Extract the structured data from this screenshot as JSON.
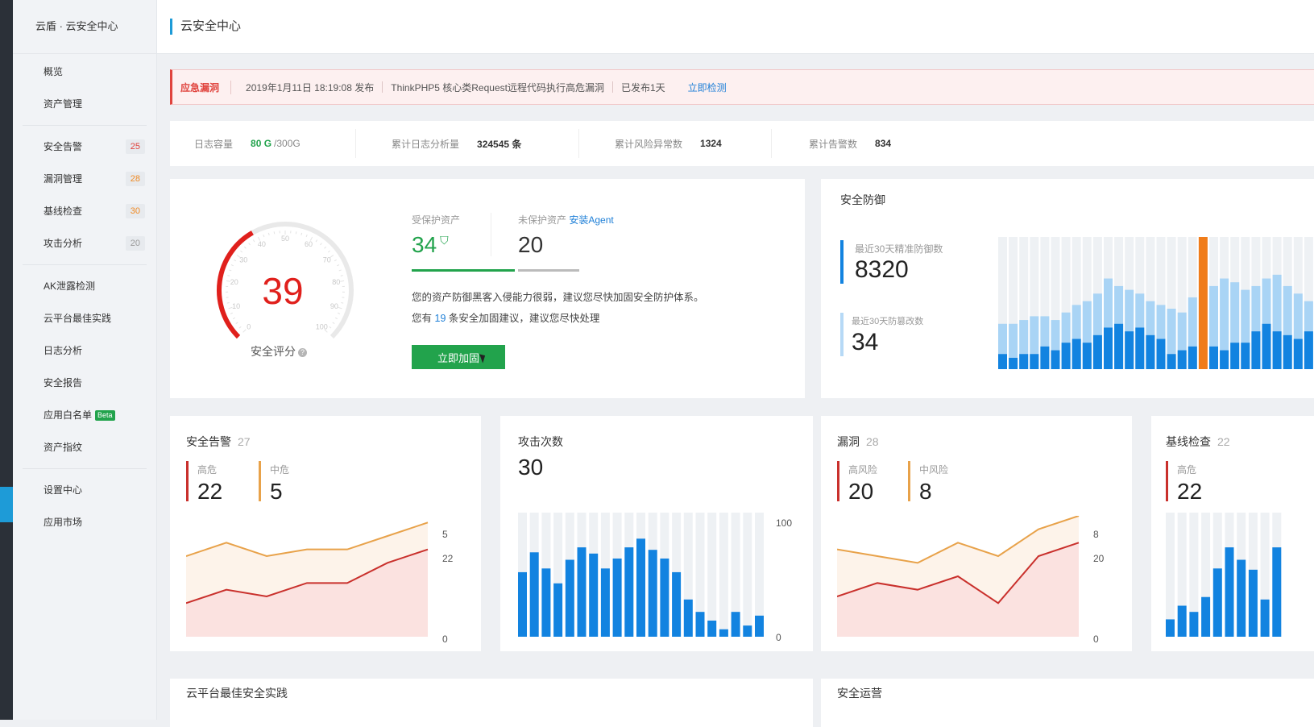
{
  "sidebar": {
    "brand": "云盾 · 云安全中心",
    "items": [
      {
        "label": "概览"
      },
      {
        "label": "资产管理"
      },
      {
        "label": "安全告警",
        "badge": "25",
        "badge_color": "#e0443e"
      },
      {
        "label": "漏洞管理",
        "badge": "28",
        "badge_color": "#f08a24"
      },
      {
        "label": "基线检查",
        "badge": "30",
        "badge_color": "#f08a24"
      },
      {
        "label": "攻击分析",
        "badge": "20",
        "badge_color": "#999999"
      },
      {
        "label": "AK泄露检测"
      },
      {
        "label": "云平台最佳实践"
      },
      {
        "label": "日志分析"
      },
      {
        "label": "安全报告"
      },
      {
        "label": "应用白名单",
        "tag": "Beta"
      },
      {
        "label": "资产指纹"
      },
      {
        "label": "设置中心"
      },
      {
        "label": "应用市场"
      }
    ]
  },
  "header": {
    "title": "云安全中心"
  },
  "alert": {
    "tag": "应急漏洞",
    "time": "2019年1月11日 18:19:08 发布",
    "title": "ThinkPHP5 核心类Request远程代码执行高危漏洞",
    "published": "已发布1天",
    "action": "立即检测"
  },
  "stats": {
    "log_capacity_label": "日志容量",
    "log_used": "80 G",
    "log_total": "/300G",
    "log_analysis_label": "累计日志分析量",
    "log_analysis_value": "324545 条",
    "risk_label": "累计风险异常数",
    "risk_value": "1324",
    "alarm_label": "累计告警数",
    "alarm_value": "834"
  },
  "score": {
    "value": "39",
    "value_num": 39,
    "label": "安全评分",
    "help_icon": "question-icon",
    "ticks": [
      "0",
      "10",
      "20",
      "30",
      "40",
      "50",
      "60",
      "70",
      "80",
      "90",
      "100"
    ],
    "protected_label": "受保护资产",
    "protected_value": "34",
    "unprotected_label": "未保护资产",
    "install_agent": "安装Agent",
    "unprotected_value": "20",
    "desc1": "您的资产防御黑客入侵能力很弱，建议您尽快加固安全防护体系。",
    "desc2_pre": "您有",
    "desc2_num": "19",
    "desc2_post": "条安全加固建议，建议您尽快处理",
    "button": "立即加固",
    "accent": "#e0201c"
  },
  "defense": {
    "title": "安全防御",
    "precise_label": "最近30天精准防御数",
    "precise_value": "8320",
    "tamper_label": "最近30天防篡改数",
    "tamper_value": "34",
    "chart_data": {
      "type": "bar",
      "series": [
        {
          "values": [
            12,
            12,
            13,
            14,
            14,
            13,
            15,
            17,
            18,
            20,
            24,
            22,
            21,
            20,
            18,
            17,
            16,
            15,
            19,
            20,
            22,
            24,
            23,
            21,
            22,
            24,
            25,
            22,
            20,
            18
          ]
        },
        {
          "values": [
            4,
            3,
            4,
            4,
            6,
            5,
            7,
            8,
            7,
            9,
            11,
            12,
            10,
            11,
            9,
            8,
            4,
            5,
            6,
            35,
            6,
            5,
            7,
            7,
            10,
            12,
            10,
            9,
            8,
            10
          ]
        }
      ],
      "highlight_index": 19,
      "highlight_color": "#f07c1a",
      "colors": [
        "#a9d4f5",
        "#1283e0"
      ]
    }
  },
  "alarms": {
    "title": "安全告警",
    "count": "27",
    "high_label": "高危",
    "high_value": "22",
    "mid_label": "中危",
    "mid_value": "5",
    "axis_top1": "5",
    "axis_top2": "22",
    "axis_bottom": "0",
    "chart_data": {
      "type": "line",
      "series": [
        {
          "values": [
            12,
            14,
            12,
            13,
            13,
            15,
            17
          ],
          "color": "#e8a24a"
        },
        {
          "values": [
            5,
            7,
            6,
            8,
            8,
            11,
            13
          ],
          "color": "#c9302c"
        }
      ],
      "ylim": [
        0,
        18
      ]
    }
  },
  "attacks": {
    "title": "攻击次数",
    "value": "30",
    "axis_top": "100",
    "axis_bottom": "0",
    "chart_data": {
      "type": "bar",
      "values": [
        52,
        68,
        55,
        43,
        62,
        72,
        67,
        55,
        63,
        72,
        79,
        70,
        63,
        52,
        30,
        20,
        13,
        6,
        20,
        9,
        17
      ],
      "ylim": [
        0,
        100
      ],
      "color": "#1283e0"
    }
  },
  "vulns": {
    "title": "漏洞",
    "count": "28",
    "high_label": "高风险",
    "high_value": "20",
    "mid_label": "中风险",
    "mid_value": "8",
    "axis_top1": "8",
    "axis_top2": "20",
    "axis_bottom": "0",
    "chart_data": {
      "type": "line",
      "series": [
        {
          "values": [
            13,
            12,
            11,
            14,
            12,
            16,
            18
          ],
          "color": "#e8a24a"
        },
        {
          "values": [
            6,
            8,
            7,
            9,
            5,
            12,
            14
          ],
          "color": "#c9302c"
        }
      ],
      "ylim": [
        0,
        18
      ]
    }
  },
  "baseline": {
    "title": "基线检查",
    "count": "22",
    "high_label": "高危",
    "high_value": "22",
    "chart_data": {
      "type": "bar",
      "values": [
        14,
        25,
        20,
        32,
        55,
        72,
        62,
        54,
        30,
        72
      ],
      "ylim": [
        0,
        100
      ],
      "color": "#1283e0"
    }
  },
  "bottom": {
    "best_practice": "云平台最佳安全实践",
    "operations": "安全运营"
  }
}
